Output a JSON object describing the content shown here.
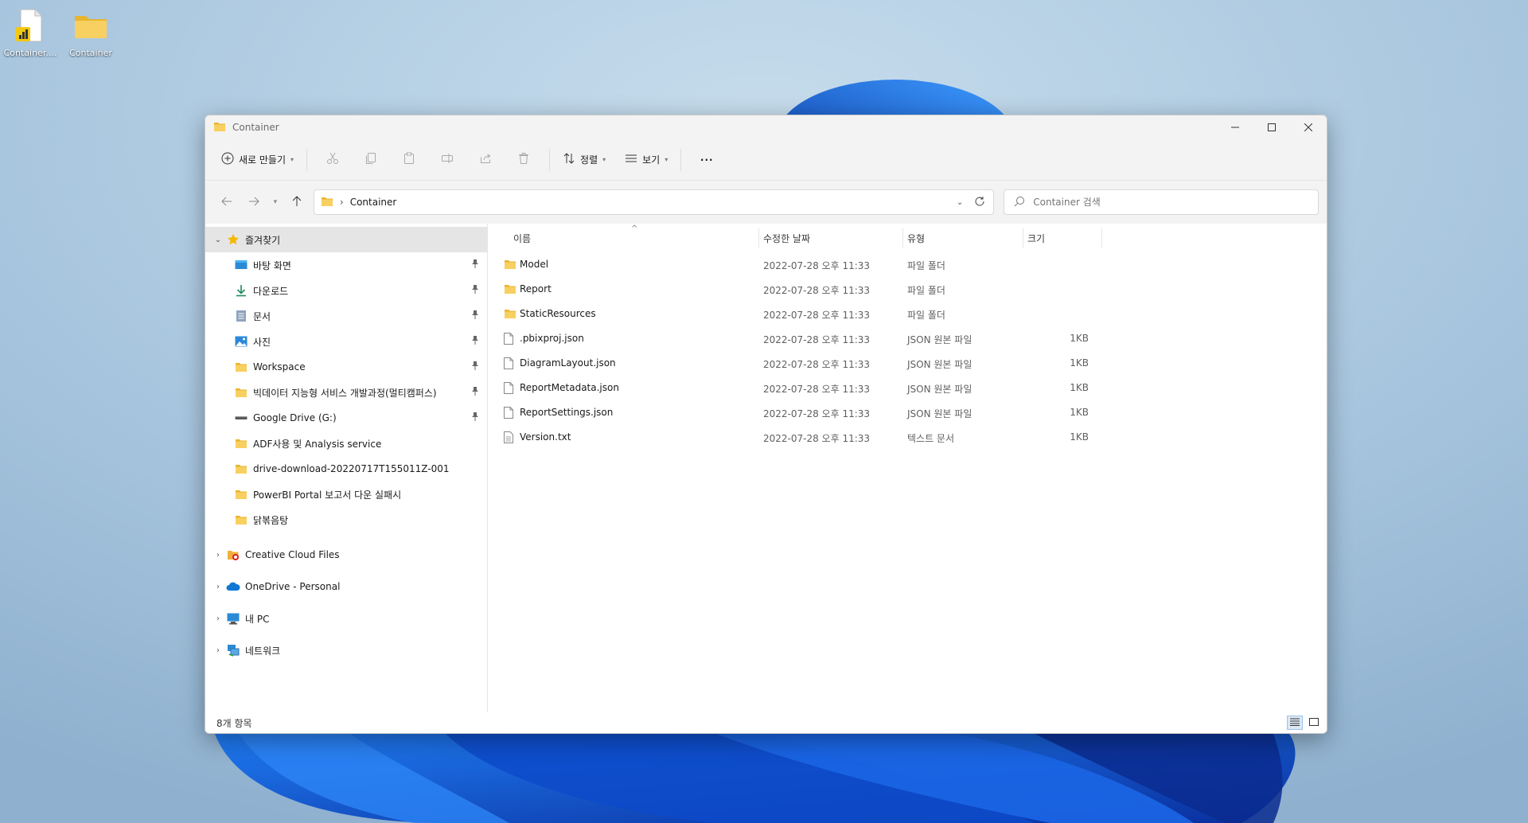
{
  "colors": {
    "folder": "#f3c94a",
    "accent": "#0067c0",
    "selected_row": "#e5e5e5"
  },
  "desktop": {
    "icons": [
      {
        "label": "Container....",
        "icon": "powerbi-file-icon"
      },
      {
        "label": "Container",
        "icon": "folder-icon"
      }
    ]
  },
  "window": {
    "title": "Container",
    "commands": {
      "new_label": "새로 만들기",
      "sort_label": "정렬",
      "view_label": "보기",
      "more_label": "···"
    },
    "address": {
      "crumb": "Container"
    },
    "search": {
      "placeholder": "Container 검색"
    }
  },
  "nav": {
    "quick_access": "즐겨찾기",
    "pinned": [
      {
        "label": "바탕 화면",
        "icon": "desktop-icon"
      },
      {
        "label": "다운로드",
        "icon": "download-icon"
      },
      {
        "label": "문서",
        "icon": "documents-icon"
      },
      {
        "label": "사진",
        "icon": "pictures-icon"
      },
      {
        "label": "Workspace",
        "icon": "folder-icon"
      },
      {
        "label": "빅데이터 지능형 서비스 개발과정(멀티캠퍼스)",
        "icon": "folder-icon"
      },
      {
        "label": "Google Drive (G:)",
        "icon": "drive-icon"
      }
    ],
    "recent": [
      {
        "label": "ADF사용 및 Analysis service",
        "icon": "folder-icon"
      },
      {
        "label": "drive-download-20220717T155011Z-001",
        "icon": "folder-icon"
      },
      {
        "label": "PowerBI Portal 보고서 다운 실패시",
        "icon": "folder-icon"
      },
      {
        "label": "닭볶음탕",
        "icon": "folder-icon"
      }
    ],
    "roots": [
      {
        "label": "Creative Cloud Files",
        "icon": "creative-cloud-icon"
      },
      {
        "label": "OneDrive - Personal",
        "icon": "onedrive-icon"
      },
      {
        "label": "내 PC",
        "icon": "pc-icon"
      },
      {
        "label": "네트워크",
        "icon": "network-icon"
      }
    ]
  },
  "columns": {
    "name": "이름",
    "modified": "수정한 날짜",
    "type": "유형",
    "size": "크기"
  },
  "files": [
    {
      "name": "Model",
      "modified": "2022-07-28 오후 11:33",
      "type": "파일 폴더",
      "size": "",
      "icon": "folder-icon"
    },
    {
      "name": "Report",
      "modified": "2022-07-28 오후 11:33",
      "type": "파일 폴더",
      "size": "",
      "icon": "folder-icon"
    },
    {
      "name": "StaticResources",
      "modified": "2022-07-28 오후 11:33",
      "type": "파일 폴더",
      "size": "",
      "icon": "folder-icon"
    },
    {
      "name": ".pbixproj.json",
      "modified": "2022-07-28 오후 11:33",
      "type": "JSON 원본 파일",
      "size": "1KB",
      "icon": "file-icon"
    },
    {
      "name": "DiagramLayout.json",
      "modified": "2022-07-28 오후 11:33",
      "type": "JSON 원본 파일",
      "size": "1KB",
      "icon": "file-icon"
    },
    {
      "name": "ReportMetadata.json",
      "modified": "2022-07-28 오후 11:33",
      "type": "JSON 원본 파일",
      "size": "1KB",
      "icon": "file-icon"
    },
    {
      "name": "ReportSettings.json",
      "modified": "2022-07-28 오후 11:33",
      "type": "JSON 원본 파일",
      "size": "1KB",
      "icon": "file-icon"
    },
    {
      "name": "Version.txt",
      "modified": "2022-07-28 오후 11:33",
      "type": "텍스트 문서",
      "size": "1KB",
      "icon": "file-icon"
    }
  ],
  "status": {
    "count": "8개 항목"
  }
}
